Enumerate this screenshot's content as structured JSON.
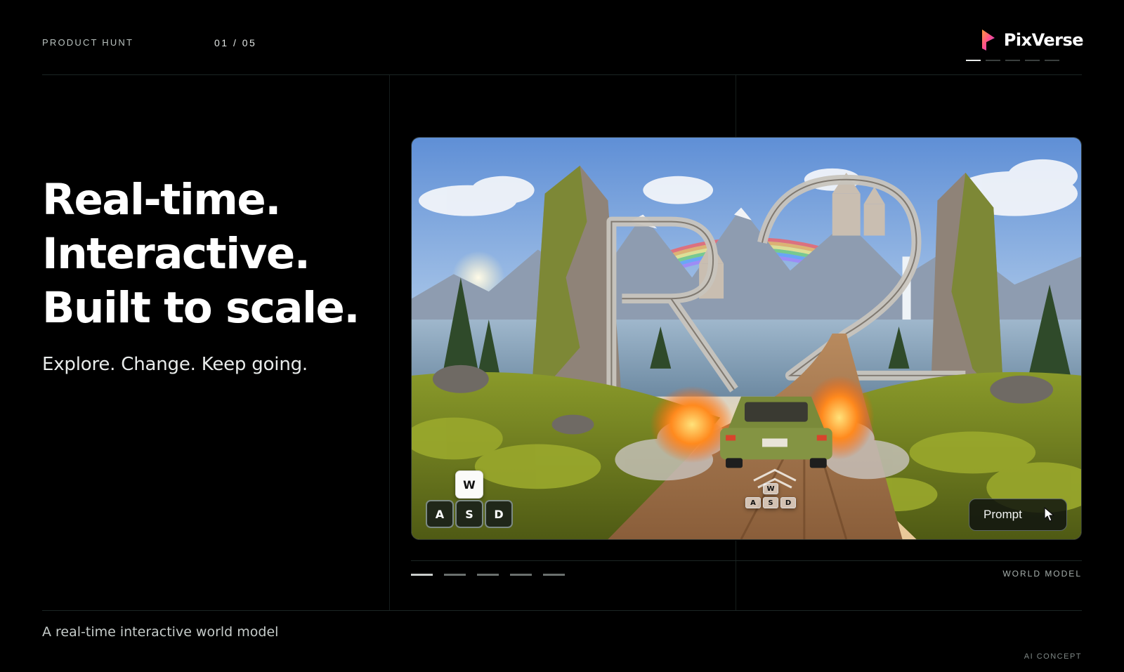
{
  "header": {
    "section_label": "PRODUCT HUNT",
    "page_counter": "01 / 05",
    "brand": "PixVerse",
    "brand_colors": [
      "#ff4e8f",
      "#b04ce0",
      "#ff9a3c"
    ],
    "slide_indicator": {
      "total": 5,
      "active": 1
    }
  },
  "hero": {
    "headline_lines": [
      "Real-time.",
      "Interactive.",
      "Built to scale."
    ],
    "subheadline": "Explore. Change. Keep going."
  },
  "media": {
    "controls": {
      "key_w": "W",
      "key_a": "A",
      "key_s": "S",
      "key_d": "D"
    },
    "overlay_keys": {
      "w": "W",
      "a": "A",
      "s": "S",
      "d": "D"
    },
    "prompt_button": "Prompt",
    "panel_label": "WORLD MODEL",
    "progress": {
      "total": 5,
      "active": 1
    }
  },
  "footer": {
    "description": "A real-time interactive world model",
    "tag": "AI CONCEPT"
  }
}
